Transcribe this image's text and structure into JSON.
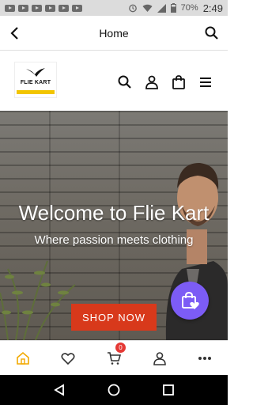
{
  "status_bar": {
    "battery": "70%",
    "time": "2:49"
  },
  "app_bar": {
    "title": "Home"
  },
  "store": {
    "logo_text": "FLIE KART"
  },
  "hero": {
    "title": "Welcome to Flie Kart",
    "subtitle": "Where passion meets clothing",
    "cta_label": "SHOP NOW"
  },
  "bottom_nav": {
    "cart_badge": "0"
  },
  "colors": {
    "accent": "#d8391b",
    "fab": "#7c5cf5",
    "home_active": "#f2a900",
    "badge": "#e53935"
  },
  "icons": [
    "back-arrow-icon",
    "search-icon",
    "user-icon",
    "bag-icon",
    "menu-icon",
    "home-icon",
    "heart-icon",
    "cart-icon",
    "more-icon"
  ]
}
